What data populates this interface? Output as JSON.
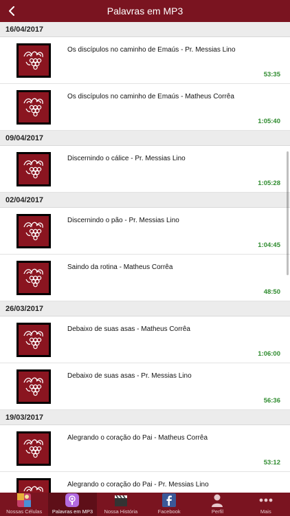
{
  "header": {
    "title": "Palavras em MP3",
    "back_icon": "chevron-left-icon"
  },
  "sections": [
    {
      "date": "16/04/2017",
      "items": [
        {
          "title": "Os discípulos no caminho de Emaús - Pr. Messias Lino",
          "duration": "53:35"
        },
        {
          "title": "Os discípulos no caminho de Emaús - Matheus Corrêa",
          "duration": "1:05:40"
        }
      ]
    },
    {
      "date": "09/04/2017",
      "items": [
        {
          "title": "Discernindo o cálice - Pr. Messias Lino",
          "duration": "1:05:28"
        }
      ]
    },
    {
      "date": "02/04/2017",
      "items": [
        {
          "title": "Discernindo o pão - Pr. Messias Lino",
          "duration": "1:04:45"
        },
        {
          "title": "Saindo da rotina - Matheus Corrêa",
          "duration": "48:50"
        }
      ]
    },
    {
      "date": "26/03/2017",
      "items": [
        {
          "title": "Debaixo de suas asas - Matheus Corrêa",
          "duration": "1:06:00"
        },
        {
          "title": "Debaixo de suas asas - Pr. Messias Lino",
          "duration": "56:36"
        }
      ]
    },
    {
      "date": "19/03/2017",
      "items": [
        {
          "title": "Alegrando o coração do Pai - Matheus Corrêa",
          "duration": "53:12"
        },
        {
          "title": "Alegrando o coração do Pai - Pr. Messias Lino",
          "duration": ""
        }
      ]
    }
  ],
  "tabs": [
    {
      "label": "Nossas Células",
      "icon": "photos-icon",
      "active": false
    },
    {
      "label": "Palavras em MP3",
      "icon": "podcast-icon",
      "active": true
    },
    {
      "label": "Nossa História",
      "icon": "clapperboard-icon",
      "active": false
    },
    {
      "label": "Facebook",
      "icon": "facebook-icon",
      "active": false
    },
    {
      "label": "Perfil",
      "icon": "person-icon",
      "active": false
    },
    {
      "label": "Mais",
      "icon": "more-dots-icon",
      "active": false
    }
  ],
  "colors": {
    "brand": "#7a1420",
    "duration": "#2e8b2e",
    "section_bg": "#ececec"
  }
}
